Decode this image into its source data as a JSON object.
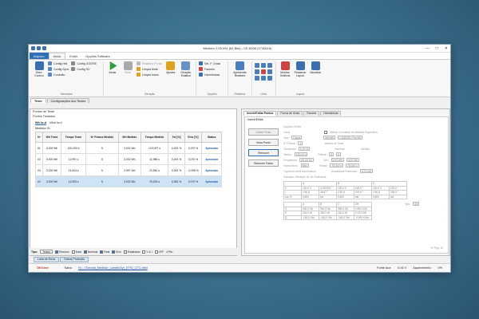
{
  "window": {
    "title": "Medidor 2.00.094 (64 Bits) - CE-6006 (1740616)",
    "controls": [
      "—",
      "□",
      "✕"
    ]
  },
  "menu": [
    "Arquivo",
    "Início",
    "Exibir",
    "Opções Software"
  ],
  "ribbon": {
    "groups": [
      {
        "label": "Hardware",
        "big": [
          {
            "label": "Direc. Conexo",
            "color": "#3a6fb0"
          }
        ],
        "small": [
          "Config Hrd",
          "Config Sync",
          "Conexão",
          "Config GOOSE",
          "Config SV"
        ]
      },
      {
        "label": "Geração",
        "big": [
          {
            "label": "Iniciar",
            "color": "#2e9e3e"
          },
          {
            "label": "Parar",
            "color": "#aaaaaa"
          },
          {
            "label": "Ajustes",
            "color": "#e0a21a"
          },
          {
            "label": "Geração Estática",
            "color": "#6a90c8"
          }
        ],
        "small": [
          "Relatório Ponto",
          "Limpar teste",
          "Limpar todos"
        ]
      },
      {
        "label": "Opções",
        "small": [
          "Sel. F. Onda",
          "Fasores",
          "Harmônicas"
        ]
      },
      {
        "label": "Relatório",
        "big": [
          {
            "label": "Apresentar Relatório",
            "color": "#4a7ec0"
          }
        ]
      },
      {
        "label": "Unid.",
        "big": []
      },
      {
        "label": "Layout",
        "big": [
          {
            "label": "Mostrar Gráficos",
            "color": "#c44"
          },
          {
            "label": "Restaurar Layout",
            "color": "#3a6fb0"
          },
          {
            "label": "Visualizar",
            "color": "#3a6fb0"
          }
        ]
      }
    ]
  },
  "tabs_main": [
    "Teste",
    "Configurações dos Testes"
  ],
  "left": {
    "header1": "Pontos de Teste",
    "header2": "Pontos Testados",
    "subtabs": [
      "Wh lo-d",
      "VArh lo-d"
    ],
    "medidor": "Medidor 01",
    "columns": [
      "Nº",
      "Wh Teste",
      "Tempo Teste",
      "Nº Pulsos Medido",
      "Wh Medido",
      "Tempo Medido",
      "Tol [%]",
      "Erro [%]",
      "Status"
    ],
    "rows": [
      [
        "01",
        "3,000 Wh",
        "120,003 s",
        "5",
        "3,002 Wh",
        "120,097 s",
        "0,200 %",
        "0,070 %",
        "Aprovado"
      ],
      [
        "02",
        "3,000 Wh",
        "11,997 s",
        "5",
        "3,002 Wh",
        "11,986 s",
        "0,200 %",
        "0,070 %",
        "Aprovado"
      ],
      [
        "03",
        "3,000 Wh",
        "24,004 s",
        "5",
        "2,997 Wh",
        "23,981 s",
        "0,300 %",
        "-0,098 %",
        "Aprovado"
      ],
      [
        "04",
        "3,000 Wh",
        "14,993 s",
        "5",
        "3,002 Wh",
        "75,003 s",
        "0,300 %",
        "0,070 %",
        "Aprovado"
      ]
    ],
    "selected_row": 3,
    "tipo": {
      "label": "Tipo:",
      "value": "Testes",
      "checks": [
        {
          "label": "Resumo",
          "on": true
        },
        {
          "label": "Data",
          "on": false
        },
        {
          "label": "Nominal",
          "on": true
        },
        {
          "label": "Real",
          "on": true
        },
        {
          "label": "Erro",
          "on": true
        },
        {
          "label": "Estatística",
          "on": false
        },
        {
          "label": "V & I",
          "on": false
        },
        {
          "label": "VFF",
          "on": false
        }
      ],
      "page": "4 Pts:"
    }
  },
  "bottom_tabs": [
    "Lista de Erros",
    "Status Proteção"
  ],
  "status": {
    "a": "ON Line",
    "b": "Salvo",
    "file": "N:\\...\\Tutorial_Medidor_Landis\\Gyr_ETSI_CTC.xMd",
    "fonte_label": "Fonte Aux:",
    "fonte_val": "0,00 V",
    "aq_label": "Aquecimento:",
    "aq_val": "0%"
  },
  "right": {
    "tabs": [
      "Inserir/Editar Pontos",
      "Forma de Onda",
      "Fasores",
      "Harmônicas"
    ],
    "subhdr": "Inserir/Editar",
    "buttons": [
      {
        "label": "Editar Ponto",
        "active": false
      },
      {
        "label": "Novo Ponto",
        "active": true
      },
      {
        "label": "Remover",
        "active": true
      },
      {
        "label": "Remover Todos",
        "active": true
      }
    ],
    "form": {
      "opcoes": "Opções Gerais",
      "geral": "Geral",
      "tipo_label": "Tipo:",
      "tipo_val": "Carga",
      "wh_label": "Wh/Wh",
      "kwh": "1,000000 / Pol Wh",
      "utilizar": "Utilizar Constante do Medidor Específica",
      "npulsos_label": "Nº Pulsos:",
      "npulsos_val": "1",
      "tol_label": "Tolerância:",
      "tol_val": "0,20 %",
      "tempo_label": "Tempo:",
      "tempo_val": "120,04 s",
      "freq_label": "Frequência:",
      "freq_val": "60,00 Hz",
      "harm_label": "Harmônicos:",
      "harm_val": "Não",
      "valores": "Valores do Teste",
      "nominal": "Nominal",
      "medido": "Medido",
      "pulsos": "Pulsos:",
      "pulsos_n": "5",
      "pulsos_m": "5",
      "wh": "Wh:",
      "wh_n": "3,00 Wh",
      "wh_m": "3,00 Wh",
      "tempo": "Tempo:",
      "tempo_n": "75,000 s",
      "tempo_m": "75,000 s",
      "qtd": "Quantidade Potências:",
      "qtd_v": "0,72 kW",
      "aviso": "* Aparece Area Harmônicos",
      "geracao": "Geração / Medição DL De Potências"
    },
    "table1": {
      "cols": [
        "",
        "A",
        "B",
        "C"
      ],
      "rows": [
        [
          "V",
          "120,0 V",
          "0,000001 °",
          "120,0 V",
          "240,0 °",
          "120,0 V",
          "120,0 °"
        ],
        [
          "I",
          "2,50 A",
          "36,87 °",
          "2,50 A",
          "276,9 °",
          "2,50 A",
          "156,9 °"
        ],
        [
          "cos Φ",
          "0,800",
          "ind",
          "0,800",
          "ind",
          "0,800",
          "ind"
        ]
      ]
    },
    "table2": {
      "cols": [
        "",
        "A",
        "B",
        "C",
        "3Φ"
      ],
      "rows": [
        [
          "S",
          "300,0 VA",
          "300,0 VA",
          "300,0 VA",
          "0,900 KVA"
        ],
        [
          "P",
          "240,0 W",
          "240,0 W",
          "240,0 W",
          "0,720 KW"
        ],
        [
          "Q",
          "-180,0 VAr",
          "-180,0 VAr",
          "-180,0 VAr",
          "-0,540 KVAr"
        ]
      ]
    },
    "tipo_label": "Tipo:",
    "tipo_val": "3Φ",
    "page_label": "Nº Pag: 16"
  }
}
